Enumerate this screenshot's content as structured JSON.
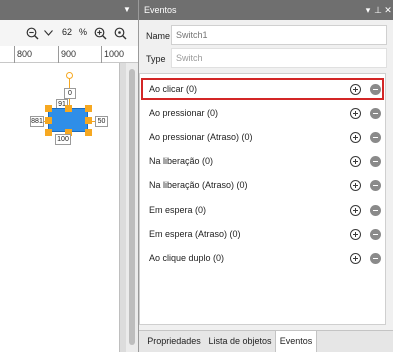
{
  "canvas": {
    "zoom_value": "62",
    "zoom_unit": "%",
    "ruler_labels": [
      "800",
      "900",
      "1000"
    ],
    "widget": {
      "top_label": "0",
      "width_label": "91",
      "left_label": "881",
      "right_label": "50",
      "bottom_label": "100"
    },
    "icons": {
      "panel_menu": "dropdown-triangle-icon",
      "zoom_out": "zoom-out-icon",
      "dropdown": "chevron-down-icon",
      "zoom_in": "zoom-in-icon",
      "zoom_fit": "zoom-fit-icon"
    }
  },
  "events_panel": {
    "title": "Eventos",
    "name_label": "Name",
    "name_placeholder": "Switch1",
    "type_label": "Type",
    "type_value": "Switch",
    "events": [
      {
        "label": "Ao clicar (0)",
        "selected": true
      },
      {
        "label": "Ao pressionar (0)",
        "selected": false
      },
      {
        "label": "Ao pressionar (Atraso) (0)",
        "selected": false
      },
      {
        "label": "Na liberação (0)",
        "selected": false
      },
      {
        "label": "Na liberação (Atraso) (0)",
        "selected": false
      },
      {
        "label": "Em espera (0)",
        "selected": false
      },
      {
        "label": "Em espera (Atraso) (0)",
        "selected": false
      },
      {
        "label": "Ao clique duplo (0)",
        "selected": false
      }
    ],
    "tabs": [
      {
        "label": "Propriedades",
        "active": false
      },
      {
        "label": "Lista de objetos",
        "active": false
      },
      {
        "label": "Eventos",
        "active": true
      }
    ],
    "title_buttons": [
      "▾",
      "⊥",
      "✕"
    ]
  },
  "colors": {
    "titlebar": "#6f6f6f",
    "selection_border": "#d32626",
    "widget_fill": "#2f8ee8",
    "handle": "#f6a821"
  }
}
